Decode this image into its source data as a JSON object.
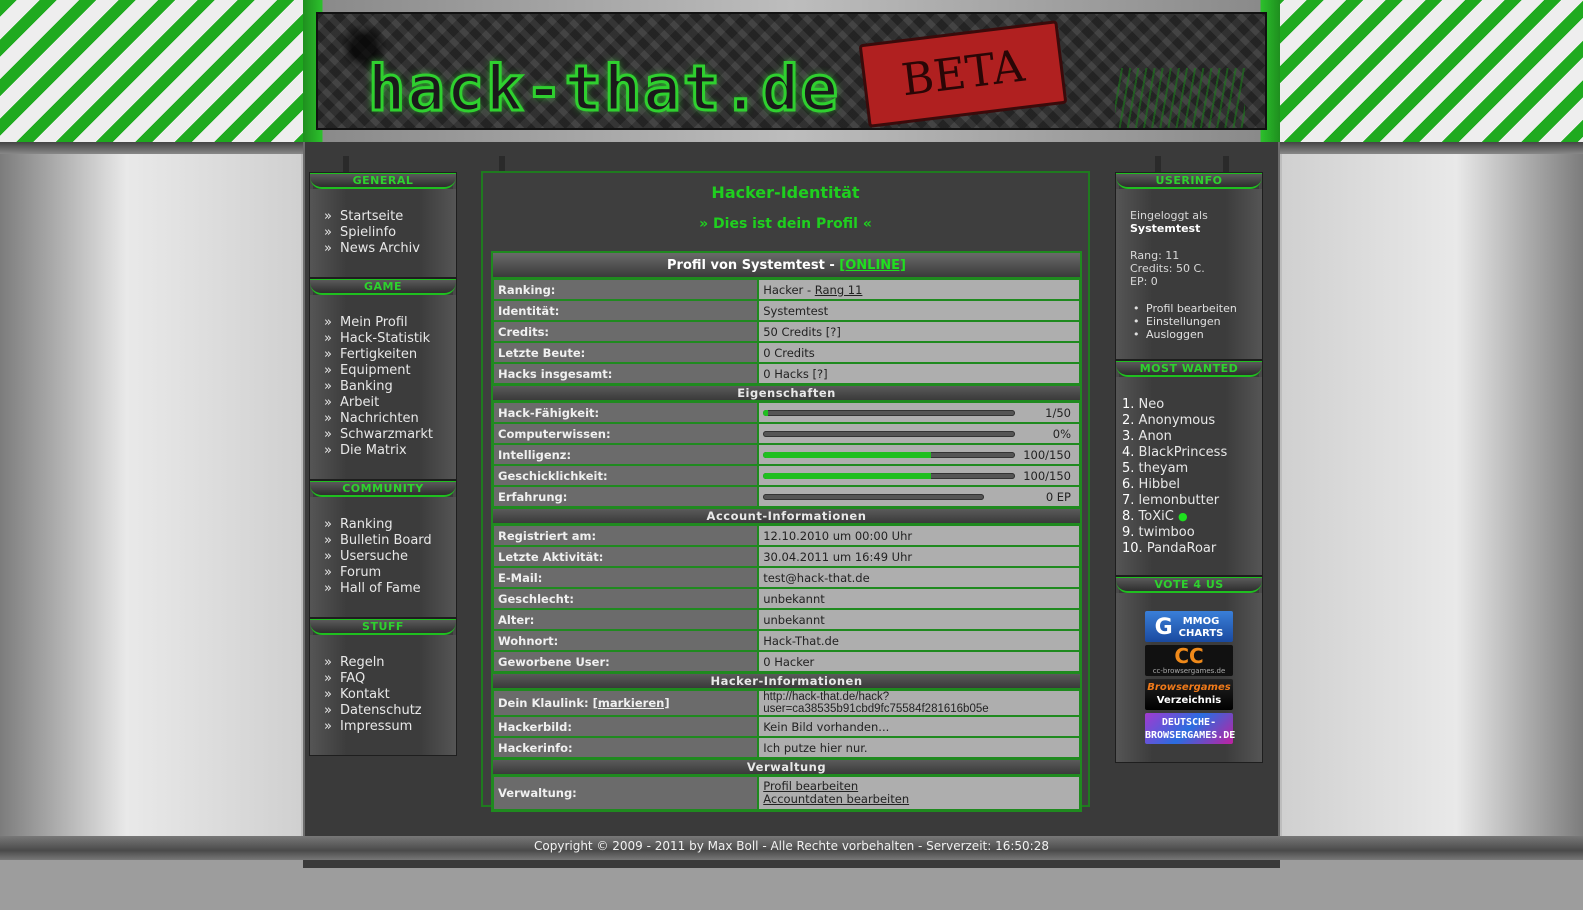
{
  "banner": {
    "logo_text": "hack-that.de",
    "badge": "BETA"
  },
  "left_sidebar": {
    "sections": [
      {
        "title": "GENERAL",
        "items": [
          "Startseite",
          "Spielinfo",
          "News Archiv"
        ]
      },
      {
        "title": "GAME",
        "items": [
          "Mein Profil",
          "Hack-Statistik",
          "Fertigkeiten",
          "Equipment",
          "Banking",
          "Arbeit",
          "Nachrichten",
          "Schwarzmarkt",
          "Die Matrix"
        ]
      },
      {
        "title": "COMMUNITY",
        "items": [
          "Ranking",
          "Bulletin Board",
          "Usersuche",
          "Forum",
          "Hall of Fame"
        ]
      },
      {
        "title": "STUFF",
        "items": [
          "Regeln",
          "FAQ",
          "Kontakt",
          "Datenschutz",
          "Impressum"
        ]
      }
    ]
  },
  "userinfo": {
    "title": "USERINFO",
    "logged_in_label": "Eingeloggt als",
    "username": "Systemtest",
    "rang": "Rang: 11",
    "credits": "Credits: 50 C.",
    "ep": "EP: 0",
    "links": [
      "Profil bearbeiten",
      "Einstellungen",
      "Ausloggen"
    ]
  },
  "most_wanted": {
    "title": "MOST WANTED",
    "entries": [
      {
        "num": "1.",
        "name": "Neo"
      },
      {
        "num": "2.",
        "name": "Anonymous"
      },
      {
        "num": "3.",
        "name": "Anon"
      },
      {
        "num": "4.",
        "name": "BlackPrincess"
      },
      {
        "num": "5.",
        "name": "theyam"
      },
      {
        "num": "6.",
        "name": "Hibbel"
      },
      {
        "num": "7.",
        "name": "lemonbutter"
      },
      {
        "num": "8.",
        "name": "ToXiC"
      },
      {
        "num": "9.",
        "name": "twimboo"
      },
      {
        "num": "10.",
        "name": "PandaRoar"
      }
    ]
  },
  "vote": {
    "title": "VOTE 4 US",
    "badges": {
      "mmog": {
        "g": "G",
        "line1": "MMOG",
        "line2": "CHARTS"
      },
      "cc": {
        "big": "CC",
        "small": "cc-browsergames.de"
      },
      "bgv": {
        "line1": "Browsergames",
        "line2": "Verzeichnis"
      },
      "dbg": {
        "line1": "DEUTSCHE-",
        "line2": "BROWSERGAMES.DE"
      }
    }
  },
  "main": {
    "title": "Hacker-Identität",
    "subtitle": "» Dies ist dein Profil «",
    "profile_head": "Profil von Systemtest - ",
    "online_status": "[ONLINE]",
    "rows1": {
      "ranking_label": "Ranking:",
      "ranking_value": "Hacker - ",
      "ranking_link": "Rang 11",
      "identitaet_label": "Identität:",
      "identitaet_value": "Systemtest",
      "credits_label": "Credits:",
      "credits_value": "50 Credits [?]",
      "beute_label": "Letzte Beute:",
      "beute_value": "0 Credits",
      "hacks_label": "Hacks insgesamt:",
      "hacks_value": "0 Hacks [?]"
    },
    "section_eigenschaften": "Eigenschaften",
    "stats": [
      {
        "label": "Hack-Fähigkeit:",
        "value": "1/50",
        "fraction": 0.02
      },
      {
        "label": "Computerwissen:",
        "value": "0%",
        "fraction": 0
      },
      {
        "label": "Intelligenz:",
        "value": "100/150",
        "fraction": 0.667
      },
      {
        "label": "Geschicklichkeit:",
        "value": "100/150",
        "fraction": 0.667
      },
      {
        "label": "Erfahrung:",
        "value": "0 EP",
        "fraction": 0
      }
    ],
    "section_account": "Account-Informationen",
    "account": [
      {
        "label": "Registriert am:",
        "value": "12.10.2010 um 00:00 Uhr"
      },
      {
        "label": "Letzte Aktivität:",
        "value": "30.04.2011 um 16:49 Uhr"
      },
      {
        "label": "E-Mail:",
        "value": "test@hack-that.de"
      },
      {
        "label": "Geschlecht:",
        "value": "unbekannt"
      },
      {
        "label": "Alter:",
        "value": "unbekannt"
      },
      {
        "label": "Wohnort:",
        "value": "Hack-That.de"
      },
      {
        "label": "Geworbene User:",
        "value": "0 Hacker"
      }
    ],
    "section_hacker": "Hacker-Informationen",
    "hacker": {
      "klaulink_label": "Dein Klaulink: ",
      "klaulink_mark": "[markieren]",
      "klaulink_value": "http://hack-that.de/hack?user=ca38535b91cbd9fc75584f281616b05e",
      "bild_label": "Hackerbild:",
      "bild_value": "Kein Bild vorhanden...",
      "info_label": "Hackerinfo:",
      "info_value": "Ich putze hier nur."
    },
    "section_verwaltung": "Verwaltung",
    "verwaltung": {
      "label": "Verwaltung:",
      "link1": "Profil bearbeiten",
      "link2": "Accountdaten bearbeiten"
    }
  },
  "footer": {
    "text": "Copyright © 2009 - 2011 by Max Boll - Alle Rechte vorbehalten - Serverzeit: 16:50:28"
  }
}
